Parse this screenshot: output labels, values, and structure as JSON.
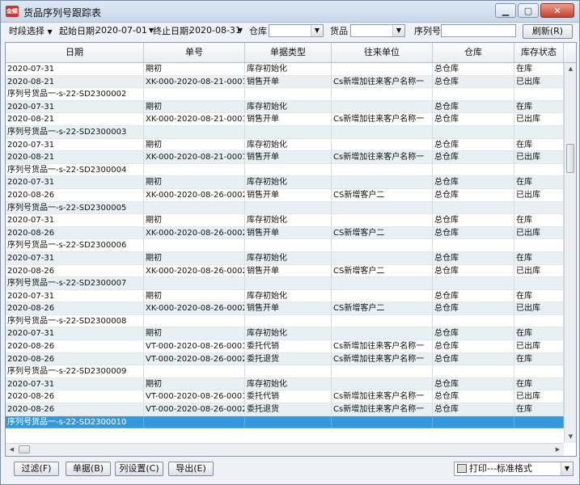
{
  "window": {
    "app_icon_text": "金蝶",
    "title": "货品序列号跟踪表",
    "min": "▁",
    "max": "▢",
    "close": "✕"
  },
  "toolbar": {
    "period_select": "时段选择",
    "start_label": "起始日期:",
    "start_date": "2020-07-01",
    "end_label": "终止日期:",
    "end_date": "2020-08-31",
    "warehouse_label": "仓库",
    "warehouse_value": "",
    "goods_label": "货品",
    "goods_value": "",
    "serial_label": "序列号",
    "serial_value": "",
    "refresh_label": "刷新(R)"
  },
  "columns": [
    "日期",
    "单号",
    "单据类型",
    "往来单位",
    "仓库",
    "库存状态"
  ],
  "rows": [
    [
      "2020-07-31",
      "期初",
      "库存初始化",
      "",
      "总仓库",
      "在库"
    ],
    [
      "2020-08-21",
      "XK-000-2020-08-21-0001",
      "销售开单",
      "Cs新增加往来客户名称一",
      "总仓库",
      "已出库"
    ],
    [
      "序列号货品一-s-22-SD2300002",
      "",
      "",
      "",
      "",
      ""
    ],
    [
      "2020-07-31",
      "期初",
      "库存初始化",
      "",
      "总仓库",
      "在库"
    ],
    [
      "2020-08-21",
      "XK-000-2020-08-21-0001",
      "销售开单",
      "Cs新增加往来客户名称一",
      "总仓库",
      "已出库"
    ],
    [
      "序列号货品一-s-22-SD2300003",
      "",
      "",
      "",
      "",
      ""
    ],
    [
      "2020-07-31",
      "期初",
      "库存初始化",
      "",
      "总仓库",
      "在库"
    ],
    [
      "2020-08-21",
      "XK-000-2020-08-21-0001",
      "销售开单",
      "Cs新增加往来客户名称一",
      "总仓库",
      "已出库"
    ],
    [
      "序列号货品一-s-22-SD2300004",
      "",
      "",
      "",
      "",
      ""
    ],
    [
      "2020-07-31",
      "期初",
      "库存初始化",
      "",
      "总仓库",
      "在库"
    ],
    [
      "2020-08-26",
      "XK-000-2020-08-26-0002",
      "销售开单",
      "CS新增客户二",
      "总仓库",
      "已出库"
    ],
    [
      "序列号货品一-s-22-SD2300005",
      "",
      "",
      "",
      "",
      ""
    ],
    [
      "2020-07-31",
      "期初",
      "库存初始化",
      "",
      "总仓库",
      "在库"
    ],
    [
      "2020-08-26",
      "XK-000-2020-08-26-0002",
      "销售开单",
      "CS新增客户二",
      "总仓库",
      "已出库"
    ],
    [
      "序列号货品一-s-22-SD2300006",
      "",
      "",
      "",
      "",
      ""
    ],
    [
      "2020-07-31",
      "期初",
      "库存初始化",
      "",
      "总仓库",
      "在库"
    ],
    [
      "2020-08-26",
      "XK-000-2020-08-26-0002",
      "销售开单",
      "CS新增客户二",
      "总仓库",
      "已出库"
    ],
    [
      "序列号货品一-s-22-SD2300007",
      "",
      "",
      "",
      "",
      ""
    ],
    [
      "2020-07-31",
      "期初",
      "库存初始化",
      "",
      "总仓库",
      "在库"
    ],
    [
      "2020-08-26",
      "XK-000-2020-08-26-0002",
      "销售开单",
      "CS新增客户二",
      "总仓库",
      "已出库"
    ],
    [
      "序列号货品一-s-22-SD2300008",
      "",
      "",
      "",
      "",
      ""
    ],
    [
      "2020-07-31",
      "期初",
      "库存初始化",
      "",
      "总仓库",
      "在库"
    ],
    [
      "2020-08-26",
      "VT-000-2020-08-26-0001",
      "委托代销",
      "Cs新增加往来客户名称一",
      "总仓库",
      "已出库"
    ],
    [
      "2020-08-26",
      "VT-000-2020-08-26-0002",
      "委托退货",
      "Cs新增加往来客户名称一",
      "总仓库",
      "在库"
    ],
    [
      "序列号货品一-s-22-SD2300009",
      "",
      "",
      "",
      "",
      ""
    ],
    [
      "2020-07-31",
      "期初",
      "库存初始化",
      "",
      "总仓库",
      "在库"
    ],
    [
      "2020-08-26",
      "VT-000-2020-08-26-0001",
      "委托代销",
      "Cs新增加往来客户名称一",
      "总仓库",
      "已出库"
    ],
    [
      "2020-08-26",
      "VT-000-2020-08-26-0002",
      "委托退货",
      "Cs新增加往来客户名称一",
      "总仓库",
      "在库"
    ],
    [
      "序列号货品一-s-22-SD2300010",
      "",
      "",
      "",
      "",
      ""
    ]
  ],
  "selected_row": 28,
  "bottom": {
    "filter": "过滤(F)",
    "document": "单据(B)",
    "columns": "列设置(C)",
    "export": "导出(E)",
    "print": "打印---标准格式"
  }
}
